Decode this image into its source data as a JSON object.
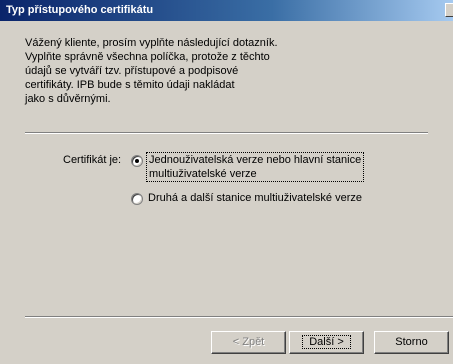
{
  "window": {
    "title": "Typ přístupového certifikátu"
  },
  "intro": {
    "lines": [
      "Vážený kliente, prosím vyplňte následující dotazník.",
      "Vyplňte správně všechna políčka, protože z těchto",
      "údajů se vytváří tzv. přístupové a podpisové",
      "certifikáty. IPB bude s těmito údaji nakládat",
      "jako s důvěrnými."
    ]
  },
  "certificate": {
    "label": "Certifikát je:",
    "options": [
      {
        "lines": [
          "Jednouživatelská verze nebo hlavní stanice",
          "multiuživatelské verze"
        ],
        "selected": true
      },
      {
        "lines": [
          "Druhá a další stanice multiuživatelské verze"
        ],
        "selected": false
      }
    ]
  },
  "buttons": {
    "back": "< Zpět",
    "next_label": "Další >",
    "cancel": "Storno"
  }
}
